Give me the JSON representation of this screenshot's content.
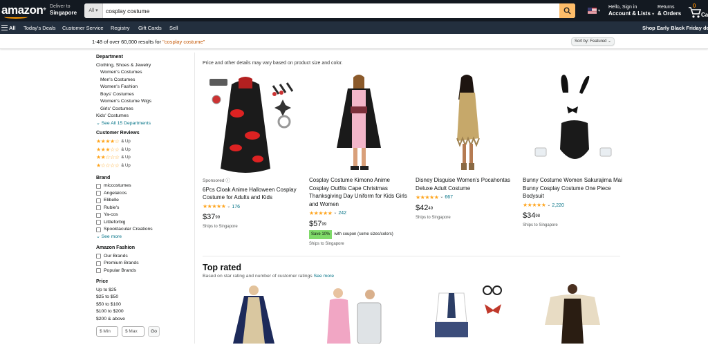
{
  "nav": {
    "logo": "amazon",
    "deliver_label": "Deliver to",
    "deliver_location": "Singapore",
    "search_category": "All",
    "search_value": "cosplay costume",
    "account_greeting": "Hello, Sign in",
    "account_label": "Account & Lists",
    "returns_label": "Returns",
    "orders_label": "& Orders",
    "cart_count": "0",
    "cart_label": "Ca"
  },
  "subnav": {
    "all_label": "All",
    "items": [
      "Today's Deals",
      "Customer Service",
      "Registry",
      "Gift Cards",
      "Sell"
    ],
    "promo": "Shop Early Black Friday dea"
  },
  "results": {
    "count_text": "1-48 of over 60,000 results for ",
    "query": "\"cosplay costume\"",
    "sort_label": "Sort by:",
    "sort_value": "Featured"
  },
  "sidebar": {
    "department_title": "Department",
    "department_top": "Clothing, Shoes & Jewelry",
    "departments": [
      "Women's Costumes",
      "Men's Costumes",
      "Women's Fashion",
      "Boys' Costumes",
      "Women's Costume Wigs",
      "Girls' Costumes"
    ],
    "kids_costumes": "Kids' Costumes",
    "see_all": "See All 15 Departments",
    "reviews_title": "Customer Reviews",
    "and_up": "& Up",
    "brand_title": "Brand",
    "brands": [
      "miccostumes",
      "Angelaicos",
      "Elibelle",
      "Rubie's",
      "Ya-cos",
      "Littleforbig",
      "Spooktacular Creations"
    ],
    "see_more": "See more",
    "fashion_title": "Amazon Fashion",
    "fashion": [
      "Our Brands",
      "Premium Brands",
      "Popular Brands"
    ],
    "price_title": "Price",
    "prices": [
      "Up to $25",
      "$25 to $50",
      "$50 to $100",
      "$100 to $200",
      "$200 & above"
    ],
    "min_placeholder": "$ Min",
    "max_placeholder": "$ Max",
    "go_label": "Go"
  },
  "main": {
    "notice": "Price and other details may vary based on product size and color.",
    "products": [
      {
        "sponsored": "Sponsored",
        "title": "6Pcs Cloak Anime Halloween Cosplay Costume for Adults and Kids",
        "rating": 4.5,
        "reviews": "176",
        "price_whole": "$37",
        "price_frac": "99",
        "ship": "Ships to Singapore"
      },
      {
        "title": "Cosplay Costume Kimono Anime Cosplay Outfits Cape Christmas Thanksgiving Day Uniform for Kids Girls and Women",
        "rating": 4.5,
        "reviews": "242",
        "price_whole": "$57",
        "price_frac": "99",
        "coupon": "Save 10%",
        "coupon_text": "with coupon (some sizes/colors)",
        "ship": "Ships to Singapore"
      },
      {
        "title": "Disney Disguise Women's Pocahontas Deluxe Adult Costume",
        "rating": 4.5,
        "reviews": "667",
        "price_whole": "$42",
        "price_frac": "49",
        "ship": "Ships to Singapore"
      },
      {
        "title": "Bunny Costume Women Sakurajima Mai Bunny Cosplay Costume One Piece Bodysuit",
        "rating": 4.5,
        "reviews": "2,220",
        "price_whole": "$34",
        "price_frac": "98",
        "ship": "Ships to Singapore"
      }
    ],
    "top_rated_title": "Top rated",
    "top_rated_sub": "Based on star rating and number of customer ratings ",
    "top_rated_link": "See more"
  },
  "colors": {
    "nav": "#131921",
    "subnav": "#232f3e",
    "accent": "#febd69",
    "link": "#007185",
    "star": "#ffa41c"
  }
}
